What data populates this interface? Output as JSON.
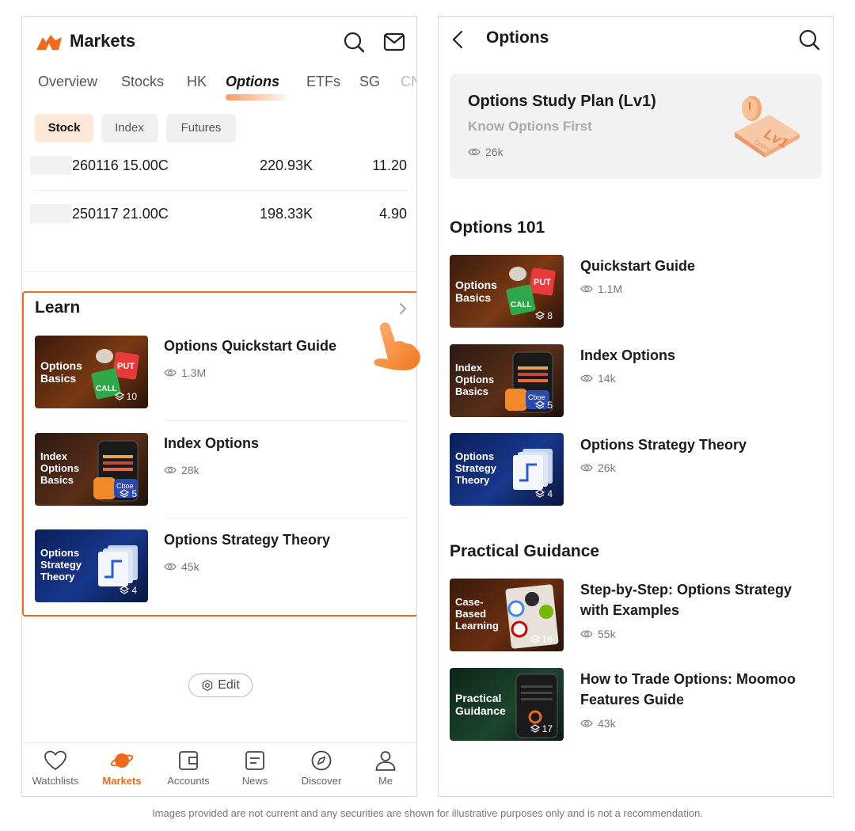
{
  "left": {
    "header": {
      "title": "Markets",
      "search_icon": "search-icon",
      "mail_icon": "mail-icon"
    },
    "tabs": [
      "Overview",
      "Stocks",
      "HK",
      "Options",
      "ETFs",
      "SG",
      "CN"
    ],
    "active_tab": "Options",
    "chips": [
      "Stock",
      "Index",
      "Futures"
    ],
    "rows": [
      {
        "code": "260116 15.00C",
        "volume": "220.93K",
        "price": "11.20"
      },
      {
        "code": "250117 21.00C",
        "volume": "198.33K",
        "price": "4.90"
      }
    ],
    "learn": {
      "title": "Learn",
      "cards": [
        {
          "thumb_text": "Options\nBasics",
          "count": "10",
          "title": "Options Quickstart Guide",
          "views": "1.3M"
        },
        {
          "thumb_text": "Index\nOptions\nBasics",
          "count": "5",
          "title": "Index Options",
          "views": "28k"
        },
        {
          "thumb_text": "Options\nStrategy\nTheory",
          "count": "4",
          "title": "Options Strategy Theory",
          "views": "45k"
        }
      ]
    },
    "edit_label": "Edit",
    "nav": [
      "Watchlists",
      "Markets",
      "Accounts",
      "News",
      "Discover",
      "Me"
    ],
    "active_nav": "Markets",
    "accent": "#f06a1c"
  },
  "right": {
    "header": {
      "title": "Options"
    },
    "plan": {
      "title": "Options Study Plan (Lv1)",
      "subtitle": "Know Options First",
      "views": "26k",
      "badge_text": "Lv1",
      "badge_sub": "Options"
    },
    "sections": [
      {
        "title": "Options 101",
        "cards": [
          {
            "thumb_text": "Options\nBasics",
            "count": "8",
            "title": "Quickstart Guide",
            "views": "1.1M"
          },
          {
            "thumb_text": "Index\nOptions\nBasics",
            "count": "5",
            "title": "Index Options",
            "views": "14k"
          },
          {
            "thumb_text": "Options\nStrategy\nTheory",
            "count": "4",
            "title": "Options Strategy Theory",
            "views": "26k"
          }
        ]
      },
      {
        "title": "Practical Guidance",
        "cards": [
          {
            "thumb_text": "Case-\nBased\nLearning",
            "count": "16",
            "title": "Step-by-Step: Options Strategy with Examples",
            "views": "55k"
          },
          {
            "thumb_text": "Practical\nGuidance",
            "count": "17",
            "title": "How to Trade Options: Moomoo Features Guide",
            "views": "43k"
          }
        ]
      }
    ]
  },
  "thumb_labels": {
    "put": "PUT",
    "call": "CALL",
    "cboe": "Cboe"
  },
  "footer": "Images provided are not current and any securities are shown for illustrative purposes only and is not a recommendation."
}
